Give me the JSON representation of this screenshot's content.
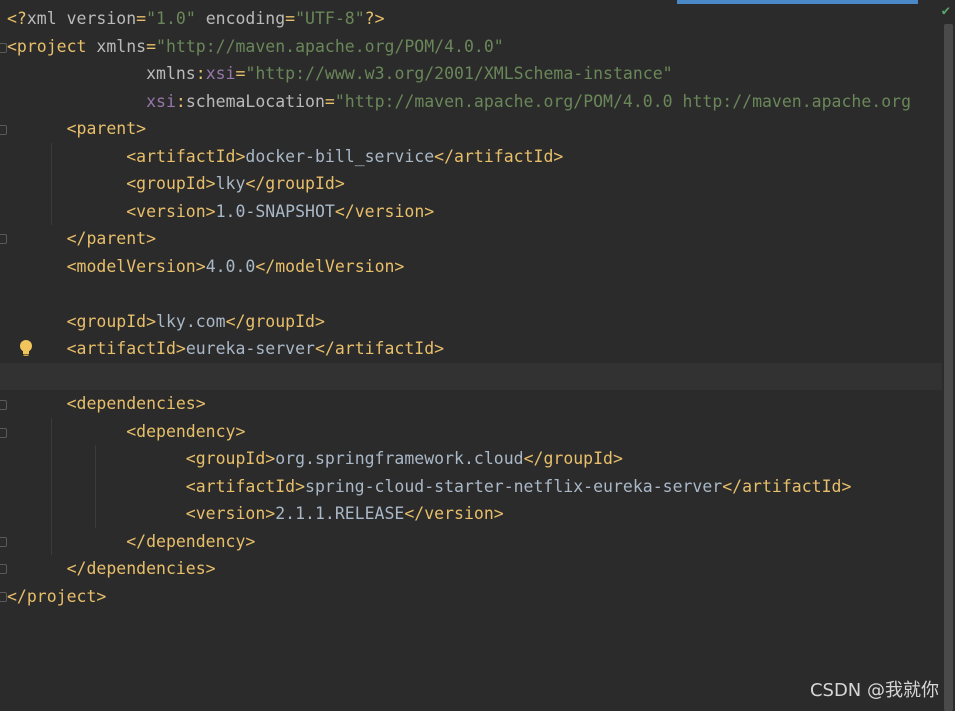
{
  "editor": {
    "lines": [
      {
        "seg": [
          [
            "tag",
            "<?"
          ],
          [
            "attr",
            "xml version"
          ],
          [
            "tag",
            "="
          ],
          [
            "val",
            "\"1.0\""
          ],
          [
            "attr",
            " encoding"
          ],
          [
            "tag",
            "="
          ],
          [
            "val",
            "\"UTF-8\""
          ],
          [
            "tag",
            "?>"
          ]
        ]
      },
      {
        "seg": [
          [
            "tag",
            "<project"
          ],
          [
            "attr",
            " xmlns"
          ],
          [
            "tag",
            "="
          ],
          [
            "val",
            "\"http://maven.apache.org/POM/4.0.0\""
          ]
        ]
      },
      {
        "seg": [
          [
            "attr",
            "              xmlns"
          ],
          [
            "tag",
            ":"
          ],
          [
            "ns",
            "xsi"
          ],
          [
            "tag",
            "="
          ],
          [
            "val",
            "\"http://www.w3.org/2001/XMLSchema-instance\""
          ]
        ]
      },
      {
        "seg": [
          [
            "ns",
            "              xsi"
          ],
          [
            "tag",
            ":"
          ],
          [
            "attr",
            "schemaLocation"
          ],
          [
            "tag",
            "="
          ],
          [
            "val",
            "\"http://maven.apache.org/POM/4.0.0 http://maven.apache.org"
          ]
        ]
      },
      {
        "seg": [
          [
            "tag",
            "      <parent>"
          ]
        ]
      },
      {
        "seg": [
          [
            "tag",
            "            <artifactId>"
          ],
          [
            "txt",
            "docker-bill_service"
          ],
          [
            "tag",
            "</artifactId>"
          ]
        ]
      },
      {
        "seg": [
          [
            "tag",
            "            <groupId>"
          ],
          [
            "txt",
            "lky"
          ],
          [
            "tag",
            "</groupId>"
          ]
        ]
      },
      {
        "seg": [
          [
            "tag",
            "            <version>"
          ],
          [
            "txt",
            "1.0-SNAPSHOT"
          ],
          [
            "tag",
            "</version>"
          ]
        ]
      },
      {
        "seg": [
          [
            "tag",
            "      </parent>"
          ]
        ]
      },
      {
        "seg": [
          [
            "tag",
            "      <modelVersion>"
          ],
          [
            "txt",
            "4.0.0"
          ],
          [
            "tag",
            "</modelVersion>"
          ]
        ]
      },
      {
        "seg": []
      },
      {
        "seg": [
          [
            "tag",
            "      <groupId>"
          ],
          [
            "txt",
            "lky.com"
          ],
          [
            "tag",
            "</groupId>"
          ]
        ]
      },
      {
        "seg": [
          [
            "tag",
            "      <artifactId>"
          ],
          [
            "txt",
            "eureka-server"
          ],
          [
            "tag",
            "</artifactId>"
          ]
        ]
      },
      {
        "seg": []
      },
      {
        "seg": [
          [
            "tag",
            "      <dependencies>"
          ]
        ]
      },
      {
        "seg": [
          [
            "tag",
            "            <dependency>"
          ]
        ]
      },
      {
        "seg": [
          [
            "tag",
            "                  <groupId>"
          ],
          [
            "txt",
            "org.springframework.cloud"
          ],
          [
            "tag",
            "</groupId>"
          ]
        ]
      },
      {
        "seg": [
          [
            "tag",
            "                  <artifactId>"
          ],
          [
            "txt",
            "spring-cloud-starter-netflix-eureka-server"
          ],
          [
            "tag",
            "</artifactId>"
          ]
        ]
      },
      {
        "seg": [
          [
            "tag",
            "                  <version>"
          ],
          [
            "txt",
            "2.1.1.RELEASE"
          ],
          [
            "tag",
            "</version>"
          ]
        ]
      },
      {
        "seg": [
          [
            "tag",
            "            </dependency>"
          ]
        ]
      },
      {
        "seg": [
          [
            "tag",
            "      </dependencies>"
          ]
        ]
      },
      {
        "seg": [
          [
            "tag",
            "</project>"
          ]
        ]
      }
    ],
    "current_line": 13,
    "bulb_line": 12,
    "fold_open_lines": [
      1,
      4,
      14,
      15
    ],
    "fold_close_lines": [
      8,
      19,
      20,
      21
    ]
  },
  "status": {
    "inspection": "✔"
  },
  "watermark": "CSDN @我就你"
}
